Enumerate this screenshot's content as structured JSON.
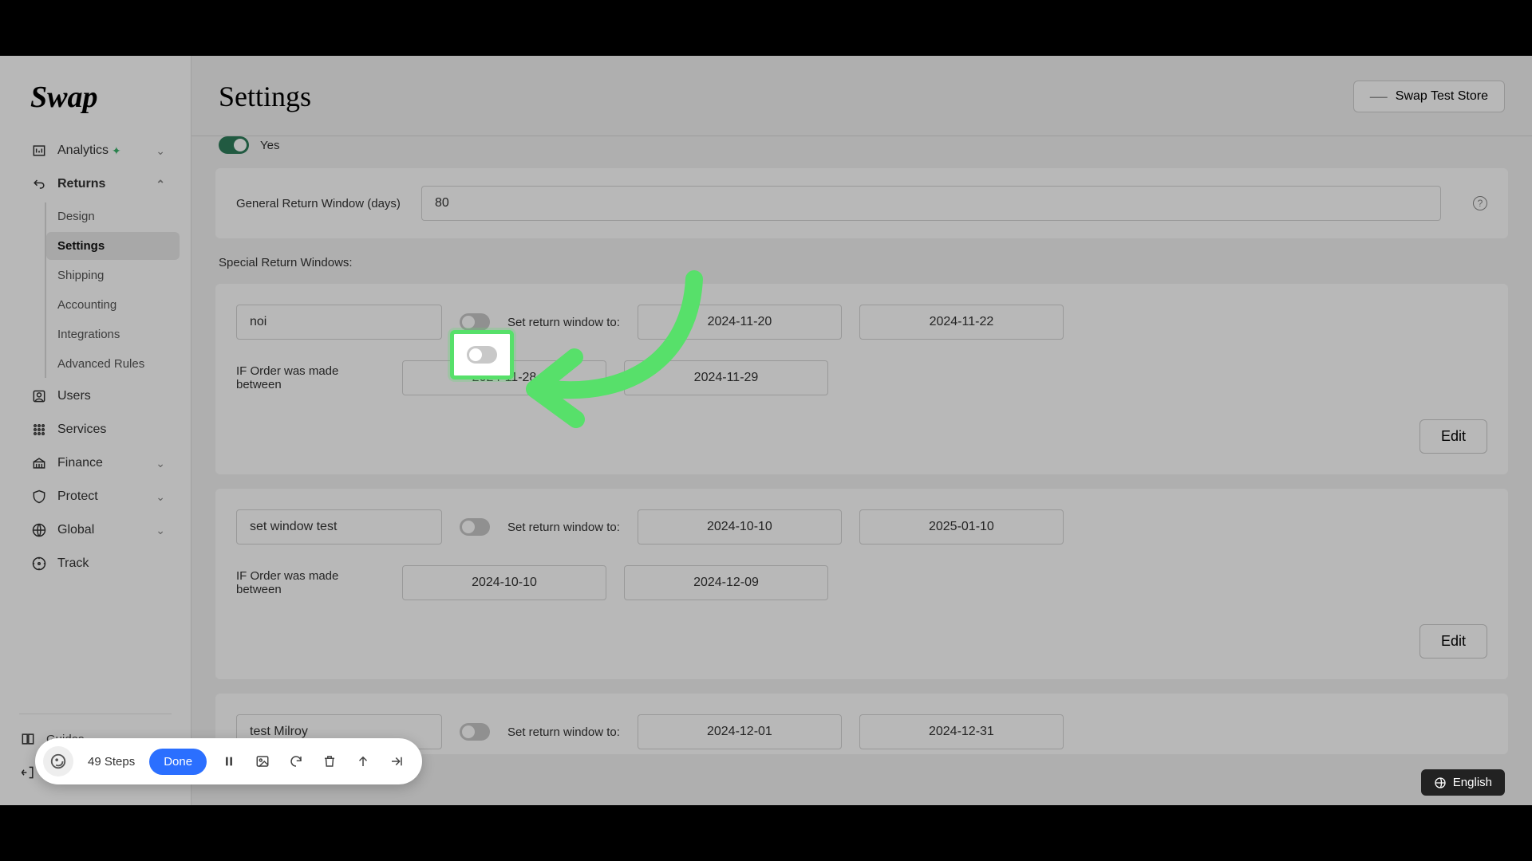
{
  "brand": "Swap",
  "page_title": "Settings",
  "store": {
    "label": "Swap Test Store"
  },
  "sidebar": {
    "analytics": "Analytics",
    "returns": "Returns",
    "sub": {
      "design": "Design",
      "settings": "Settings",
      "shipping": "Shipping",
      "accounting": "Accounting",
      "integrations": "Integrations",
      "advanced_rules": "Advanced Rules"
    },
    "users": "Users",
    "services": "Services",
    "finance": "Finance",
    "protect": "Protect",
    "global": "Global",
    "track": "Track",
    "guides": "Guides",
    "logout": "Logout"
  },
  "peek": {
    "yes": "Yes"
  },
  "general": {
    "label": "General Return Window (days)",
    "value": "80"
  },
  "special_label": "Special Return Windows:",
  "set_return_label": "Set return window to:",
  "cond_label": "IF Order was made between",
  "edit_label": "Edit",
  "windows": [
    {
      "name": "noi",
      "toggle_on": false,
      "set_from": "2024-11-20",
      "set_to": "2024-11-22",
      "cond_from": "2024-11-28",
      "cond_to": "2024-11-29"
    },
    {
      "name": "set window test",
      "toggle_on": false,
      "set_from": "2024-10-10",
      "set_to": "2025-01-10",
      "cond_from": "2024-10-10",
      "cond_to": "2024-12-09"
    },
    {
      "name": "test Milroy",
      "toggle_on": false,
      "set_from": "2024-12-01",
      "set_to": "2024-12-31"
    }
  ],
  "toolbar": {
    "steps": "49 Steps",
    "done": "Done"
  },
  "language": "English"
}
